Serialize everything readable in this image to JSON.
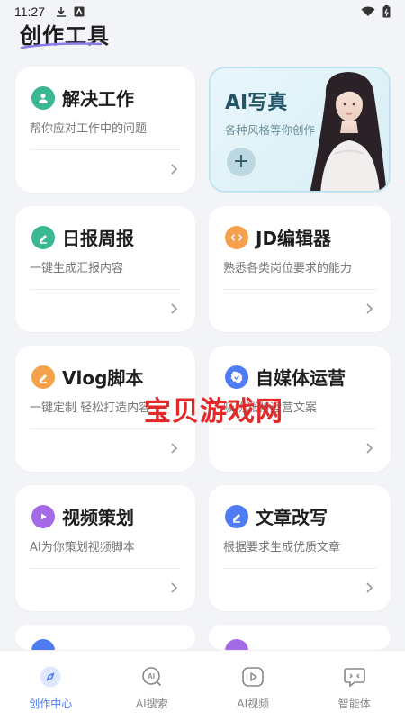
{
  "status": {
    "time": "11:27"
  },
  "page_title": "创作工具",
  "ai_card": {
    "title": "AI写真",
    "subtitle": "各种风格等你创作",
    "plus": "+"
  },
  "cards": [
    {
      "title": "解决工作",
      "subtitle": "帮你应对工作中的问题",
      "icon": "person-icon",
      "color": "#3bb792"
    },
    {
      "title": "日报周报",
      "subtitle": "一键生成汇报内容",
      "icon": "pen-icon",
      "color": "#3bb792"
    },
    {
      "title": "JD编辑器",
      "subtitle": "熟悉各类岗位要求的能力",
      "icon": "code-icon",
      "color": "#f5a04a"
    },
    {
      "title": "Vlog脚本",
      "subtitle": "一键定制 轻松打造内容",
      "icon": "pen-icon",
      "color": "#f5a04a"
    },
    {
      "title": "自媒体运营",
      "subtitle": "吸粉涨粉运营文案",
      "icon": "badge-icon",
      "color": "#4f7cf5"
    },
    {
      "title": "视频策划",
      "subtitle": "AI为你策划视频脚本",
      "icon": "play-icon",
      "color": "#a56ae8"
    },
    {
      "title": "文章改写",
      "subtitle": "根据要求生成优质文章",
      "icon": "pen-icon",
      "color": "#4f7cf5"
    }
  ],
  "watermark": "宝贝游戏网",
  "nav": [
    {
      "label": "创作中心",
      "icon": "compass-icon",
      "active": true
    },
    {
      "label": "AI搜索",
      "icon": "ai-search-icon",
      "active": false
    },
    {
      "label": "AI视频",
      "icon": "video-icon",
      "active": false
    },
    {
      "label": "智能体",
      "icon": "chat-bot-icon",
      "active": false
    }
  ],
  "colors": {
    "accent": "#4f7cf5",
    "background": "#f3f4f8",
    "watermark": "#e32a2a"
  }
}
